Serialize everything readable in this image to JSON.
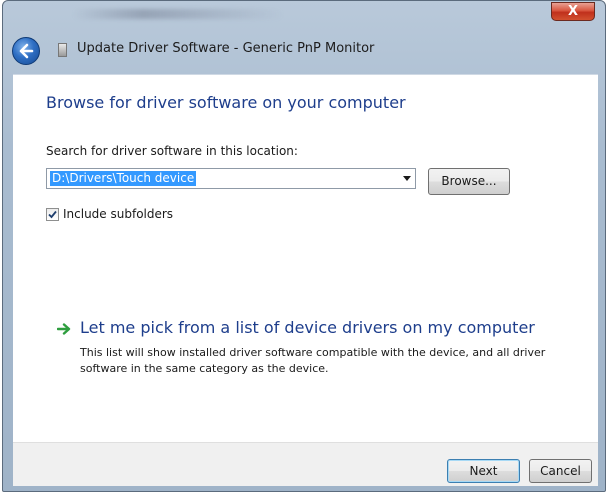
{
  "window": {
    "close_glyph": "X"
  },
  "header": {
    "back_icon": "back-arrow-icon",
    "title": "Update Driver Software - Generic PnP Monitor"
  },
  "main": {
    "heading": "Browse for driver software on your computer",
    "search_label": "Search for driver software in this location:",
    "path_value": "D:\\Drivers\\Touch device",
    "browse_label": "Browse...",
    "include_subfolders_label": "Include subfolders",
    "include_subfolders_checked": true,
    "pick_link": "Let me pick from a list of device drivers on my computer",
    "pick_description": "This list will show installed driver software compatible with the device, and all driver software in the same category as the device."
  },
  "footer": {
    "next_label": "Next",
    "cancel_label": "Cancel"
  },
  "colors": {
    "heading": "#1e3e8c",
    "selection": "#3399ff",
    "link_arrow": "#2e9e3f"
  }
}
